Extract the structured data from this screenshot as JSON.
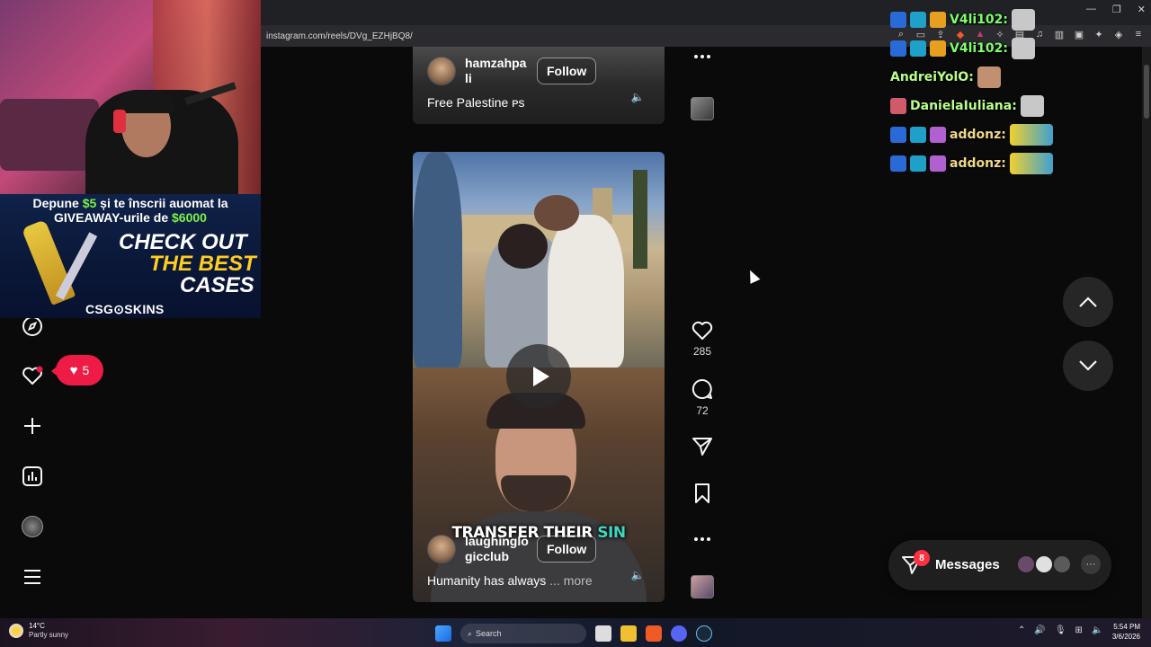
{
  "browser": {
    "url": "instagram.com/reels/DVg_EZHjBQ8/",
    "window_controls": [
      "minimize",
      "restore",
      "close"
    ]
  },
  "webcam_overlay": {
    "ad": {
      "line1_pre": "Depune",
      "line1_amount": "$5",
      "line1_post": "și te înscrii auomat la",
      "line2_pre": "GIVEAWAY-urile de",
      "line2_amount": "$6000",
      "headline1": "CHECK OUT",
      "headline2": "THE BEST",
      "headline3": "CASES",
      "brand": "CSG⊙SKINS"
    }
  },
  "sidebar": {
    "icons": [
      "explore-icon",
      "notifications-icon",
      "create-icon",
      "dashboard-icon",
      "profile-avatar",
      "more-menu-icon"
    ],
    "notification_count": "5"
  },
  "reel_previous": {
    "author": "hamzahpa\nli",
    "author_line1": "hamzahpa",
    "author_line2": "li",
    "follow_label": "Follow",
    "description": "Free Palestine 🇵🇸",
    "description_text": "Free Palestine ᴘs"
  },
  "reel_current": {
    "overlay_text_white": "TRANSFER THEIR",
    "overlay_text_accent": "SIN",
    "author_line1": "laughinglo",
    "author_line2": "gicclub",
    "follow_label": "Follow",
    "description": "Humanity has always",
    "more_label": "... more",
    "likes": "285",
    "comments": "72"
  },
  "chat": {
    "lines": [
      {
        "user": "V4li102:",
        "color": "#7dff6a",
        "badges": 3
      },
      {
        "user": "V4li102:",
        "color": "#7dff6a",
        "badges": 3
      },
      {
        "user": "AndreiYolO:",
        "color": "#b9ff8a",
        "badges": 0
      },
      {
        "user": "DanielaIuliana:",
        "color": "#b9ff8a",
        "badges": 1
      },
      {
        "user": "addonz:",
        "color": "#f0d88a",
        "badges": 3
      },
      {
        "user": "addonz:",
        "color": "#f0d88a",
        "badges": 3
      }
    ]
  },
  "messages": {
    "label": "Messages",
    "unread": "8"
  },
  "taskbar": {
    "temperature": "14°C",
    "weather": "Partly sunny",
    "search_placeholder": "Search",
    "time": "5:54 PM",
    "date": "3/6/2026"
  },
  "colors": {
    "instagram_red": "#ed1b45",
    "page_bg": "#0a0a0a",
    "ad_green": "#7cf04a",
    "ad_yellow": "#ffcc22",
    "overlay_teal": "#3fd6c0"
  }
}
